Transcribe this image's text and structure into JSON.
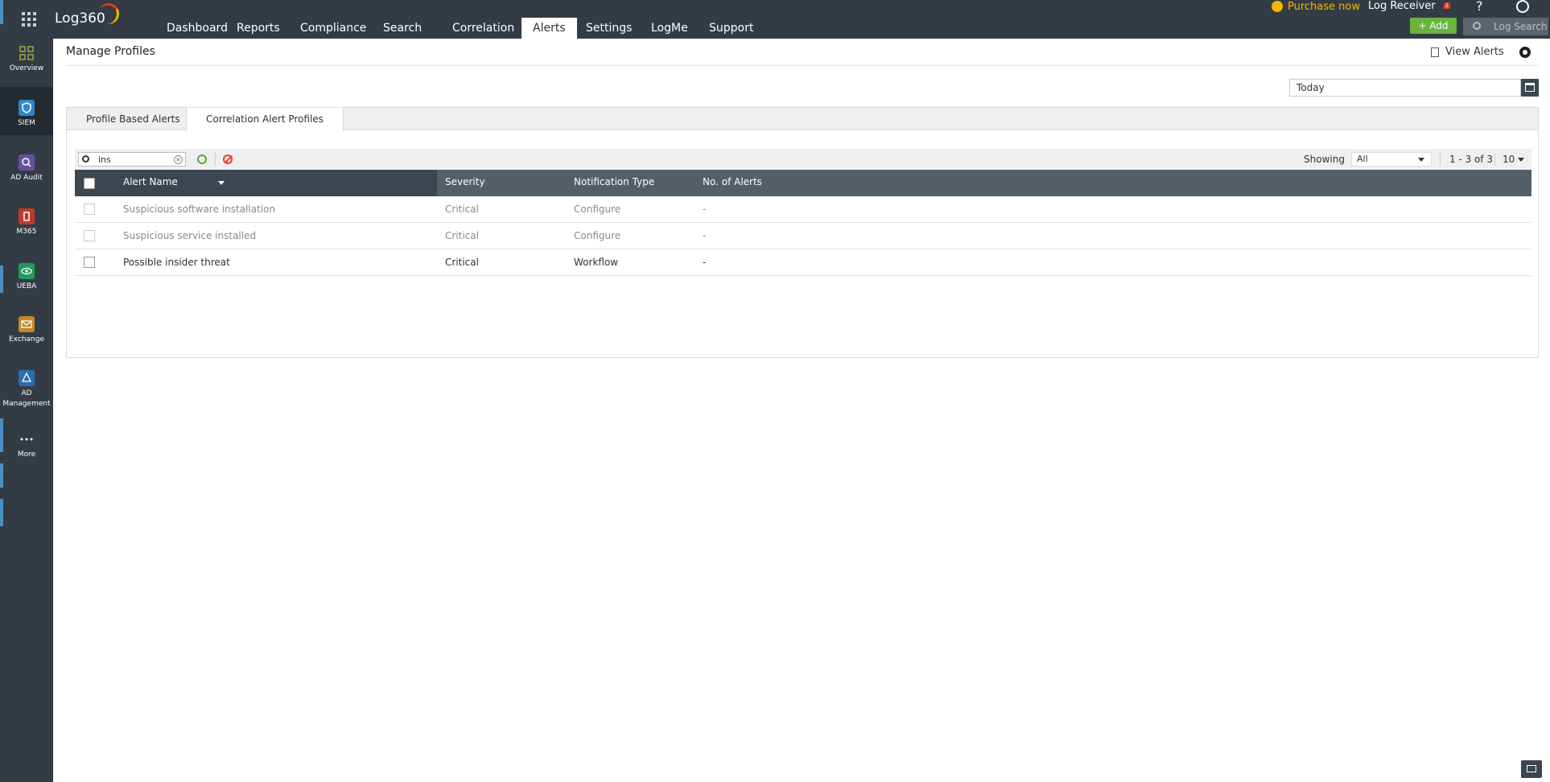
{
  "app": {
    "logo": "Log360"
  },
  "sidebar": {
    "items": [
      {
        "label": "Overview",
        "icon": "overview-grid-icon",
        "color": "#8a8f4a"
      },
      {
        "label": "SIEM",
        "icon": "shield-icon",
        "color": "#2f86c8",
        "active": true
      },
      {
        "label": "AD Audit",
        "icon": "ad-audit-icon",
        "color": "#6a4fa0"
      },
      {
        "label": "M365",
        "icon": "m365-office-icon",
        "color": "#c0392b"
      },
      {
        "label": "UEBA",
        "icon": "ueba-eye-icon",
        "color": "#1e9c5a"
      },
      {
        "label": "Exchange",
        "icon": "exchange-mail-icon",
        "color": "#c08a2a"
      },
      {
        "label": "AD",
        "label2": "Management",
        "icon": "ad-management-icon",
        "color": "#2a6fb0"
      },
      {
        "label": "More",
        "icon": "more-dots-icon",
        "color": "#333c44"
      }
    ]
  },
  "topnav": {
    "tabs": [
      "Dashboard",
      "Reports",
      "Compliance",
      "Search",
      "Correlation",
      "Alerts",
      "Settings",
      "LogMe",
      "Support"
    ],
    "active": "Alerts",
    "purchase": "Purchase now",
    "log_receiver": "Log Receiver",
    "notification_count": "2",
    "help": "?",
    "add_label": "+ Add",
    "log_search_placeholder": "Log Search"
  },
  "page": {
    "title": "Manage Profiles",
    "view_alerts": "View Alerts",
    "date_range": "Today"
  },
  "subtabs": [
    "Profile Based Alerts",
    "Correlation Alert Profiles"
  ],
  "active_subtab": "Correlation Alert Profiles",
  "filter": {
    "search_value": "ins",
    "showing_label": "Showing",
    "showing_value": "All",
    "page_info": "1 - 3 of 3",
    "per_page": "10"
  },
  "table": {
    "columns": [
      "Alert Name",
      "Severity",
      "Notification Type",
      "No. of Alerts"
    ],
    "rows": [
      {
        "name": "Suspicious software installation",
        "severity": "Critical",
        "notification": "Configure",
        "count": "-",
        "disabled": true,
        "link": true
      },
      {
        "name": "Suspicious service installed",
        "severity": "Critical",
        "notification": "Configure",
        "count": "-",
        "disabled": true,
        "link": true
      },
      {
        "name": "Possible insider threat",
        "severity": "Critical",
        "notification": "Workflow",
        "count": "-",
        "disabled": false,
        "link": false
      }
    ]
  },
  "colors": {
    "topbar": "#333c44",
    "accent_green": "#69b33f",
    "link_blue": "#2f86c8",
    "purchase_yellow": "#f7b500"
  }
}
